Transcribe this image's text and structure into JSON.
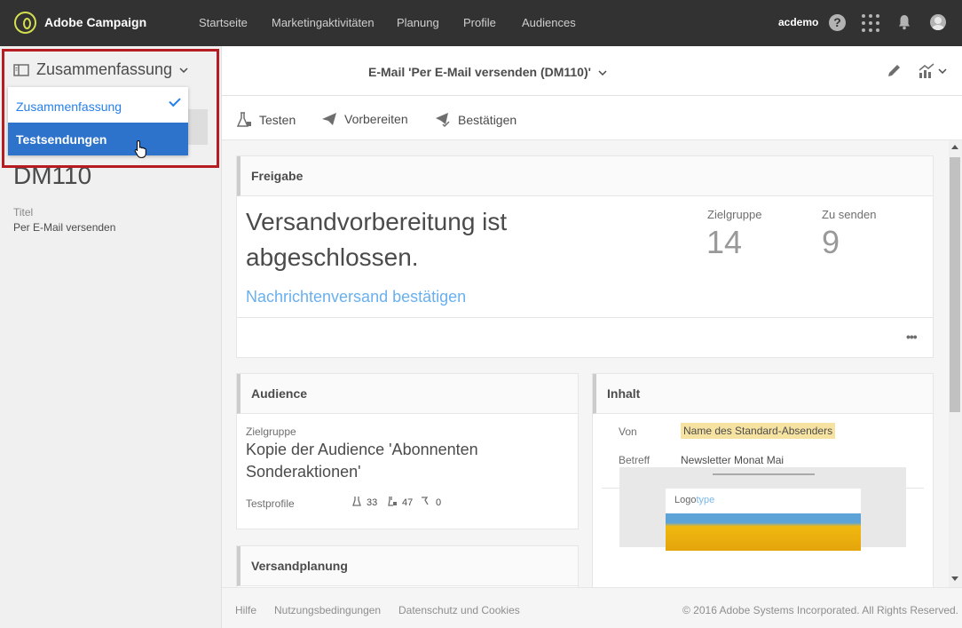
{
  "topbar": {
    "brand": "Adobe Campaign",
    "nav": [
      "Startseite",
      "Marketingaktivitäten",
      "Planung",
      "Profile",
      "Audiences"
    ],
    "user": "acdemo",
    "help": "?"
  },
  "left": {
    "menu_label": "Zusammenfassung",
    "dropdown": [
      "Zusammenfassung",
      "Testsendungen"
    ],
    "id": "DM110",
    "title_label": "Titel",
    "title_value": "Per E-Mail versenden"
  },
  "header": {
    "title": "E-Mail 'Per E-Mail versenden (DM110)'"
  },
  "toolbar": {
    "test": "Testen",
    "prepare": "Vorbereiten",
    "confirm": "Bestätigen"
  },
  "freigabe": {
    "heading": "Freigabe",
    "status_line1": "Versandvorbereitung ist",
    "status_line2": "abgeschlossen.",
    "link": "Nachrichtenversand bestätigen",
    "target_label": "Zielgruppe",
    "target_value": "14",
    "send_label": "Zu senden",
    "send_value": "9",
    "more": "•••"
  },
  "audience": {
    "heading": "Audience",
    "target_label": "Zielgruppe",
    "target_line1": "Kopie der Audience 'Abonnenten",
    "target_line2": "Sonderaktionen'",
    "test_label": "Testprofile",
    "c1": "33",
    "c2": "47",
    "c3": "0"
  },
  "inhalt": {
    "heading": "Inhalt",
    "from_label": "Von",
    "from_value": "Name des Standard-Absenders",
    "subject_label": "Betreff",
    "subject_value": "Newsletter Monat Mai",
    "logo_text1": "Logo",
    "logo_text2": "type"
  },
  "planung": {
    "heading": "Versandplanung"
  },
  "footer": {
    "help": "Hilfe",
    "terms": "Nutzungsbedingungen",
    "privacy": "Datenschutz und Cookies",
    "copyright": "© 2016 Adobe Systems Incorporated. All Rights Reserved."
  }
}
